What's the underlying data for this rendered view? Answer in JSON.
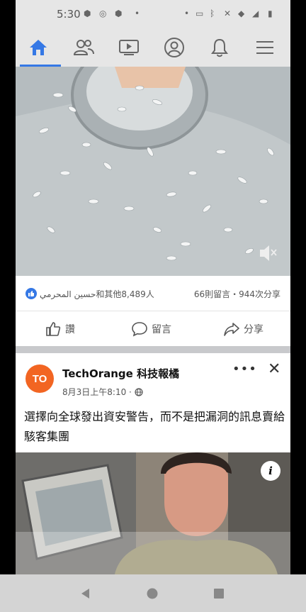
{
  "status_bar": {
    "time": "5:30"
  },
  "nav": {
    "tabs": [
      {
        "name": "home-icon",
        "active": true
      },
      {
        "name": "friends-icon",
        "active": false
      },
      {
        "name": "watch-icon",
        "active": false
      },
      {
        "name": "profile-icon",
        "active": false
      },
      {
        "name": "notifications-icon",
        "active": false
      },
      {
        "name": "menu-icon",
        "active": false
      }
    ],
    "accent_color": "#3578e5"
  },
  "post1": {
    "reactions_text": "حسين المحرمي和其他8,489人",
    "comments_shares": "66則留言・944次分享",
    "like_label": "讚",
    "comment_label": "留言",
    "share_label": "分享"
  },
  "post2": {
    "avatar_text": "TO",
    "page_name": "TechOrange 科技報橘",
    "timestamp": "8月3日上午8:10 ·",
    "text": "選擇向全球發出資安警告，而不是把漏洞的訊息賣給駭客集團",
    "more_label": "•••"
  },
  "colors": {
    "brand_orange": "#f26522",
    "like_blue": "#3578e5"
  }
}
